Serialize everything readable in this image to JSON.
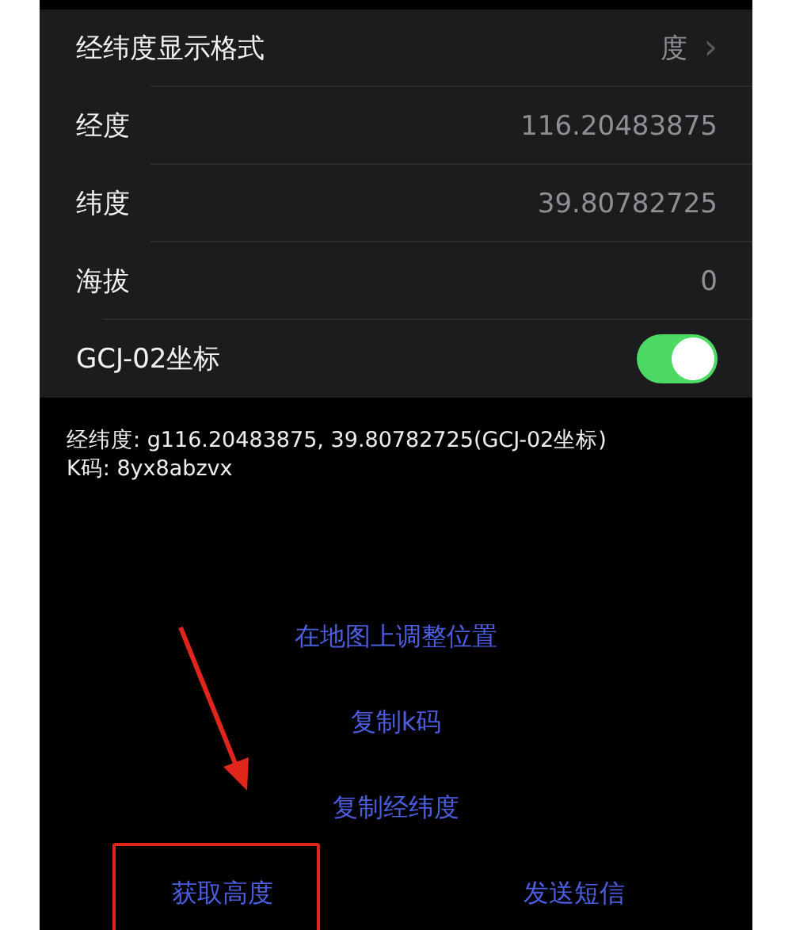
{
  "settings": [
    {
      "kind": "disclosure",
      "label": "经纬度显示格式",
      "value": "度",
      "chevron": "›"
    },
    {
      "kind": "value",
      "label": "经度",
      "value": "116.20483875"
    },
    {
      "kind": "value",
      "label": "纬度",
      "value": "39.80782725"
    },
    {
      "kind": "value",
      "label": "海拔",
      "value": "0"
    },
    {
      "kind": "toggle",
      "label": "GCJ-02坐标",
      "on": true
    }
  ],
  "info_lines": [
    "经纬度: g116.20483875, 39.80782725(GCJ-02坐标)",
    "K码: 8yx8abzvx"
  ],
  "actions": [
    "在地图上调整位置",
    "复制k码",
    "复制经纬度"
  ],
  "bottom_actions": [
    "获取高度",
    "发送短信"
  ],
  "annotations": {
    "arrow": true,
    "highlight_box": true
  }
}
